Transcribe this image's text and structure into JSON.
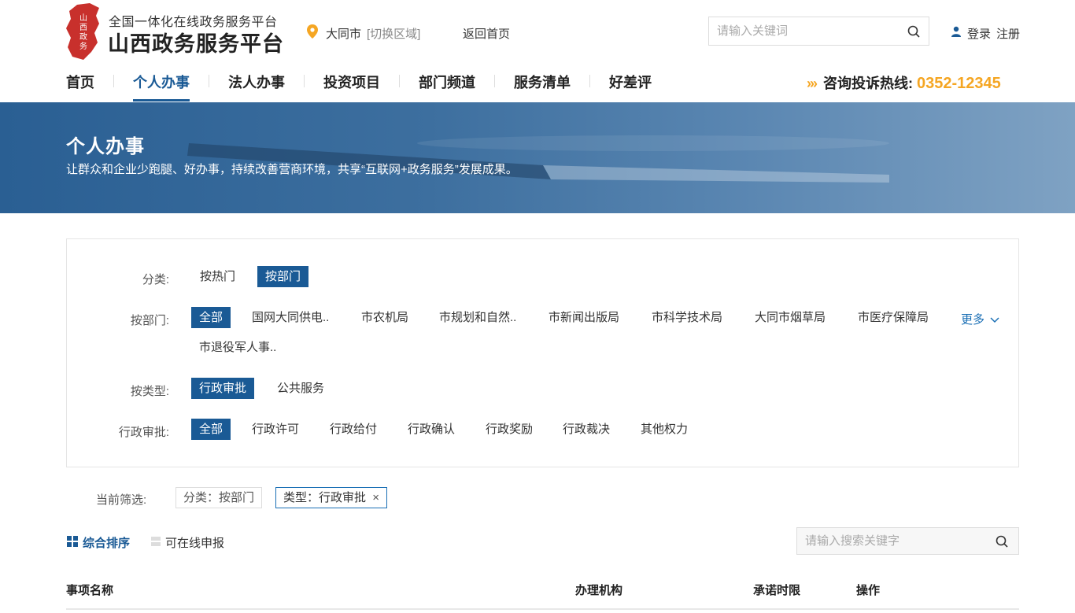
{
  "header": {
    "logo_sub": "全国一体化在线政务服务平台",
    "logo_main": "山西政务服务平台",
    "logo_mark_text": "山西政务",
    "location_city": "大同市",
    "location_switch": "[切换区域]",
    "home_link": "返回首页",
    "search_placeholder": "请输入关键词",
    "login": "登录",
    "register": "注册"
  },
  "nav": {
    "items": [
      "首页",
      "个人办事",
      "法人办事",
      "投资项目",
      "部门频道",
      "服务清单",
      "好差评"
    ],
    "active": "个人办事",
    "hotline_label": "咨询投诉热线:",
    "hotline_number": "0352-12345"
  },
  "banner": {
    "title": "个人办事",
    "desc": "让群众和企业少跑腿、好办事，持续改善营商环境，共享“互联网+政务服务”发展成果。"
  },
  "filters": {
    "category": {
      "label": "分类:",
      "options": [
        "按热门",
        "按部门"
      ],
      "selected": "按部门"
    },
    "department": {
      "label": "按部门:",
      "options": [
        "全部",
        "国网大同供电..",
        "市农机局",
        "市规划和自然..",
        "市新闻出版局",
        "市科学技术局",
        "大同市烟草局",
        "市医疗保障局",
        "市退役军人事.."
      ],
      "selected": "全部",
      "more": "更多"
    },
    "type": {
      "label": "按类型:",
      "options": [
        "行政审批",
        "公共服务"
      ],
      "selected": "行政审批"
    },
    "admin": {
      "label": "行政审批:",
      "options": [
        "全部",
        "行政许可",
        "行政给付",
        "行政确认",
        "行政奖励",
        "行政裁决",
        "其他权力"
      ],
      "selected": "全部"
    }
  },
  "current_filter": {
    "label": "当前筛选:",
    "tags": [
      "分类：按部门",
      "类型：行政审批"
    ]
  },
  "sort": {
    "comprehensive": "综合排序",
    "online": "可在线申报",
    "search_placeholder": "请输入搜索关键字"
  },
  "table": {
    "headers": [
      "事项名称",
      "办理机构",
      "承诺时限",
      "操作"
    ]
  },
  "colors": {
    "primary": "#1a5a95",
    "accent": "#f5a623",
    "logo_red": "#c8302c"
  }
}
